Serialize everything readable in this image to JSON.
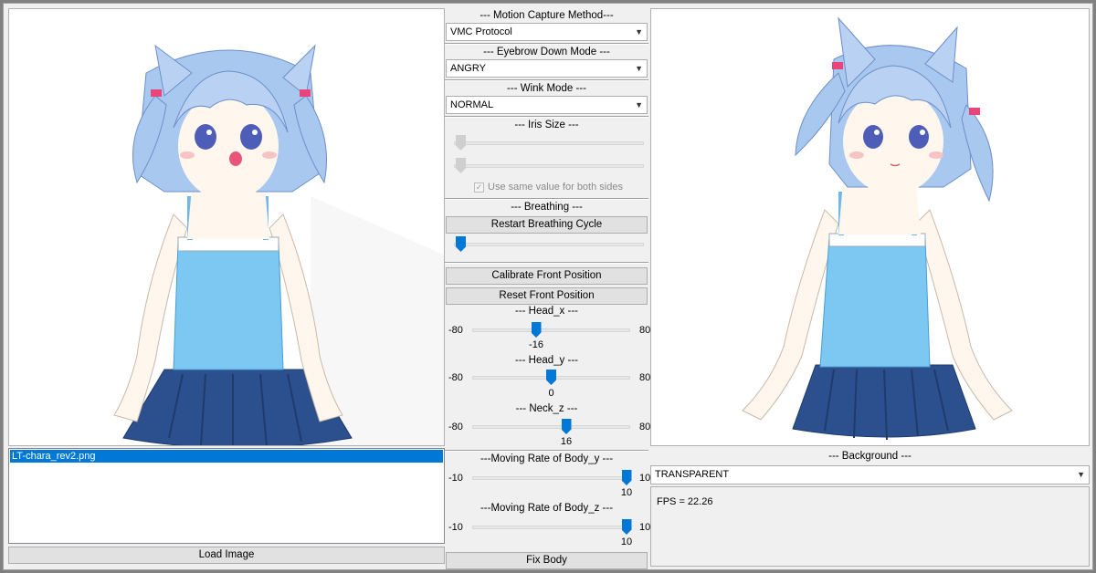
{
  "left_panel": {
    "file_list": [
      "LT-chara_rev2.png"
    ],
    "load_button": "Load Image"
  },
  "controls": {
    "motion_capture": {
      "title": "--- Motion Capture Method---",
      "selected": "VMC Protocol"
    },
    "eyebrow": {
      "title": "--- Eyebrow Down Mode ---",
      "selected": "ANGRY"
    },
    "wink": {
      "title": "--- Wink Mode ---",
      "selected": "NORMAL"
    },
    "iris": {
      "title": "--- Iris Size ---",
      "checkbox_label": "Use same value for both sides",
      "checkbox_checked": true
    },
    "breathing": {
      "title": "--- Breathing ---",
      "restart_button": "Restart Breathing Cycle",
      "slider_fraction": 0.0
    },
    "calibrate_button": "Calibrate Front Position",
    "reset_button": "Reset Front Position",
    "head_x": {
      "title": "--- Head_x ---",
      "min": "-80",
      "max": "80",
      "value": "-16",
      "fraction": 0.4
    },
    "head_y": {
      "title": "--- Head_y ---",
      "min": "-80",
      "max": "80",
      "value": "0",
      "fraction": 0.5
    },
    "neck_z": {
      "title": "--- Neck_z ---",
      "min": "-80",
      "max": "80",
      "value": "16",
      "fraction": 0.6
    },
    "body_y": {
      "title": "---Moving Rate of Body_y ---",
      "min": "-10",
      "max": "10",
      "value": "10",
      "fraction": 1.0
    },
    "body_z": {
      "title": "---Moving Rate of Body_z ---",
      "min": "-10",
      "max": "10",
      "value": "10",
      "fraction": 1.0
    },
    "fix_button": "Fix Body"
  },
  "right_panel": {
    "background": {
      "title": "--- Background ---",
      "selected": "TRANSPARENT"
    },
    "fps_text": "FPS = 22.26"
  },
  "colors": {
    "accent": "#0078d7",
    "hair": "#a9c8f0",
    "top": "#7cc8f2",
    "skirt": "#2c4f8e"
  }
}
